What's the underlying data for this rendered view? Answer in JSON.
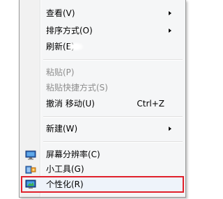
{
  "menu": {
    "items": [
      {
        "label": "查看(V)",
        "submenu": true
      },
      {
        "label": "排序方式(O)",
        "submenu": true
      },
      {
        "label": "刷新(E)"
      },
      {
        "label": "粘贴(P)",
        "disabled": true
      },
      {
        "label": "粘贴快捷方式(S)",
        "disabled": true
      },
      {
        "label": "撤消 移动(U)",
        "shortcut": "Ctrl+Z"
      },
      {
        "label": "新建(W)",
        "submenu": true
      },
      {
        "label": "屏幕分辨率(C)",
        "icon": "screen-resolution-icon"
      },
      {
        "label": "小工具(G)",
        "icon": "gadgets-icon"
      },
      {
        "label": "个性化(R)",
        "icon": "personalize-icon",
        "highlighted": true
      }
    ]
  },
  "colors": {
    "highlight_border": "#e0202a",
    "disabled_text": "#8d8d8d",
    "menu_background": "#f5f6f7"
  }
}
